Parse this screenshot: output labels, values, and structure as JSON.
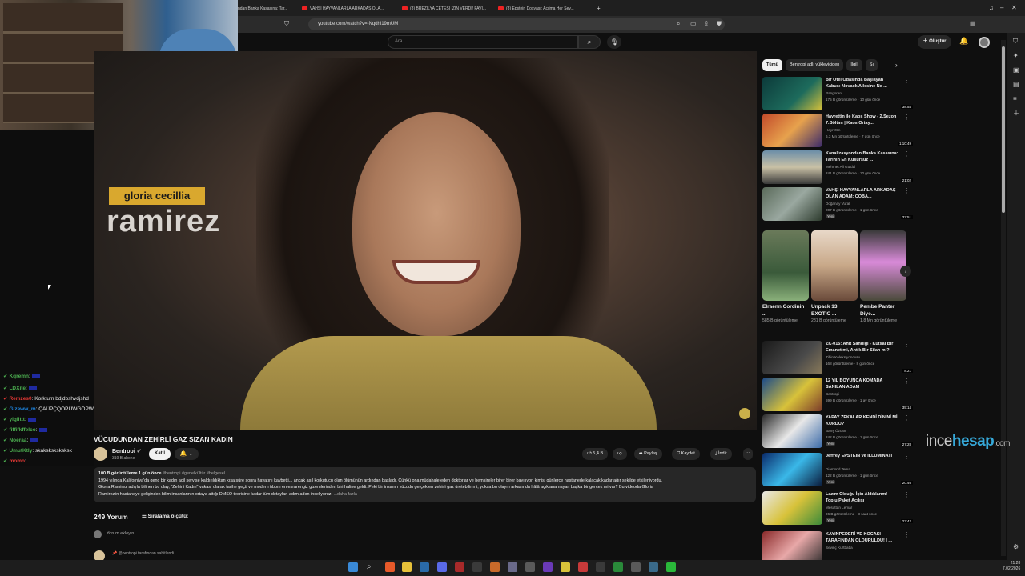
{
  "browser": {
    "tabs": [
      {
        "label": "ndan Banka Kasasına: Tar..."
      },
      {
        "label": "VAHŞİ HAYVANLARLA ARKADAŞ OLA..."
      },
      {
        "label": "(8) BREZİLYA ÇETESİ İZİN VERDİ! FAVI..."
      },
      {
        "label": "(8) Epstein Dosyası: Açılma Her Şey..."
      }
    ],
    "new_tab": "+",
    "url": "youtube.com/watch?v=-Nqdhi19mUM"
  },
  "header": {
    "search_placeholder": "Ara",
    "create_label": "Oluştur"
  },
  "chat": [
    {
      "user": "Kqremn",
      "msg": ":",
      "color": "#4caf50"
    },
    {
      "user": "LDXite",
      "msg": ":",
      "color": "#4caf50"
    },
    {
      "user": "Remzes0",
      "msg": ": Korktum bdjdbshvdjshd",
      "color": "#e53935"
    },
    {
      "user": "Gizeww_m",
      "msg": ": ÇAÜPÇQÖPÜWĞÖPWĞŞÖĞPÖWWWPĞÇWŞ",
      "color": "#1e88e5"
    },
    {
      "user": "yiglittt",
      "msg": ":",
      "color": "#4caf50"
    },
    {
      "user": "fiffifkffelco",
      "msg": ":",
      "color": "#4caf50"
    },
    {
      "user": "Noeraa",
      "msg": ":",
      "color": "#4caf50"
    },
    {
      "user": "UmutKtly",
      "msg": ": skaksksksksksk",
      "color": "#4caf50"
    },
    {
      "user": "momo",
      "msg": ":",
      "color": "#e53935"
    }
  ],
  "video": {
    "overlay_first": "gloria cecillia",
    "overlay_last": "ramirez",
    "title": "VÜCUDUNDAN ZEHİRLİ GAZ SIZAN KADIN"
  },
  "channel": {
    "name": "Bentropi",
    "subscribers": "319 B abone",
    "join_label": "Katıl",
    "bell_label": "🔔 ⌄"
  },
  "actions": {
    "likes": "5,4 B",
    "share": "Paylaş",
    "save": "Kaydet",
    "download": "İndir",
    "more": "⋯"
  },
  "description": {
    "meta": "100 B görüntüleme  1 gün önce",
    "tags": "#bentropi #genelkültür #belgesel",
    "line1": "1994 yılında Kaliforniya'da genç bir kadın acil servise kaldırıldıktan kısa süre sonra hayatını kaybetti... ancak asıl korkutucu olan ölümünün ardından başladı. Çünkü ona müdahale eden doktorlar ve hemşireler birer birer bayılıyor, kimisi günlerce hastanede kalacak kadar ağır şekilde etkileniyordu.",
    "line2": "Gloria Ramirez adıyla bilinen bu olay, \"Zehirli Kadın\" vakası olarak tarihe geçti ve modern tıbbın en esrarengiz gizemlerinden biri haline geldi. Peki bir insanın vücudu gerçekten zehirli gaz üretebilir mi, yoksa bu olayın arkasında hâlâ açıklanamayan başka bir gerçek mi var? Bu videoda Gloria",
    "line3": "Ramirez'in hastaneye gelişinden bilim insanlarının ortaya attığı DMSO teorisine kadar tüm detayları adım adım inceliyoruz.",
    "more": "...daha fazla"
  },
  "comments": {
    "count": "249 Yorum",
    "sort": "Sıralama ölçütü:",
    "add_placeholder": "Yorum ekleyin...",
    "first_note": "📌 @bentropi tarafından sabitlendi"
  },
  "chips": [
    "Tümü",
    "Bentropi adlı yükleyiciden",
    "İlgili",
    "Sı"
  ],
  "recommendations": [
    {
      "title": "Bir Otel Odasında Başlayan Kabus: Novack Ailesine Ne ...",
      "channel": "Pangoran",
      "meta": "175 B görüntüleme · 10 gün önce",
      "duration": "38:54",
      "badge": "",
      "thumb": "linear-gradient(135deg,#0c3a3a,#1d6b5c 60%,#d8c23a)"
    },
    {
      "title": "Hayrettin ile Kaos Show - 2.Sezon 7.Bölüm | Kaos Ortay...",
      "channel": "Hayrettin",
      "meta": "6,3 Mn görüntüleme · 7 gün önce",
      "duration": "1:10:49",
      "badge": "",
      "thumb": "linear-gradient(135deg,#c24a2a,#e7a24d 50%,#3a2a6a)"
    },
    {
      "title": "Kanalizasyondan Banka Kasasına: Tarihin En Kusursuz ...",
      "channel": "Mehmet Ali Güldal",
      "meta": "241 B görüntüleme · 10 gün önce",
      "duration": "21:02",
      "badge": "",
      "thumb": "linear-gradient(180deg,#6b8ea8,#c9c1a6 50%,#3a3a3a)"
    },
    {
      "title": "VAHŞİ HAYVANLARLA ARKADAŞ OLAN ADAM: ÇOBA...",
      "channel": "Doğanay Vural",
      "meta": "207 B görüntüleme · 1 gün önce",
      "duration": "32:51",
      "badge": "Yeni",
      "thumb": "linear-gradient(135deg,#5a6a5a,#9aa8a0 50%,#2c3a2c)"
    },
    {
      "title": "ZK-015: Ahit Sandığı - Kutsal Bir Emanet mi, Antik Bir Silah mı?",
      "channel": "Zihin Koleksiyoncusu",
      "meta": "168 görüntüleme · 8 gün önce",
      "duration": "8:21",
      "badge": "",
      "thumb": "linear-gradient(135deg,#1a1a1a,#4a4a4a 60%,#8a7a5a)"
    },
    {
      "title": "12 YIL BOYUNCA KOMADA SANILAN ADAM",
      "channel": "Bentropi",
      "meta": "599 B görüntüleme · 1 ay önce",
      "duration": "35:14",
      "badge": "",
      "thumb": "linear-gradient(135deg,#1a4a8a,#d8c23a 55%,#7a3a2a)"
    },
    {
      "title": "YAPAY ZEKALAR KENDİ DİNİNİ Mİ KURDU?",
      "channel": "Barış Özcan",
      "meta": "242 B görüntüleme · 1 gün önce",
      "duration": "27:28",
      "badge": "Yeni",
      "thumb": "linear-gradient(135deg,#2a2a2a,#e8e8e8 50%,#3a6aa8)"
    },
    {
      "title": "Jeffrey EPSTEIN ve ILLUMINATI !",
      "channel": "Diamond Tema",
      "meta": "122 B görüntüleme · 1 gün önce",
      "duration": "20:46",
      "badge": "Yeni",
      "thumb": "linear-gradient(135deg,#0a2a6a,#3ab8e8 50%,#0a1a3a)"
    },
    {
      "title": "Lazım Olduğu İçin Aldıklarım! Toplu Paket Açılışı",
      "channel": "Mesuttan Lemar",
      "meta": "96 B görüntüleme · 3 saat önce",
      "duration": "23:42",
      "badge": "Yeni",
      "thumb": "linear-gradient(135deg,#e8e8e8,#d8c23a 50%,#3a8a3a)"
    },
    {
      "title": "KAYINPEDERİ VE KOCASI TARAFINDAN ÖLDÜRÜLDÜ! | ...",
      "channel": "Sevinç Kurtbaba",
      "meta": "",
      "duration": "",
      "badge": "",
      "thumb": "linear-gradient(135deg,#8a2a2a,#e8a8a8 50%,#2a2a2a)"
    }
  ],
  "shorts": [
    {
      "title": "Elraenn Cordinin ...",
      "views": "585 B görüntüleme",
      "thumb": "linear-gradient(180deg,#6a7a5a,#3a5a3a 60%,#8ab07a)"
    },
    {
      "title": "Unpack 13 EXOTIC ...",
      "views": "281 B görüntüleme",
      "thumb": "linear-gradient(180deg,#e8d8c8,#c8a888 50%,#6a4a3a)"
    },
    {
      "title": "Pembe Panter Diye...",
      "views": "1,8 Mn görüntüleme",
      "thumb": "linear-gradient(180deg,#3a3a3a,#d88ad8 45%,#4a4a3a)"
    }
  ],
  "watermark": {
    "a": "ince",
    "b": "hesap",
    "c": ".com"
  },
  "taskbar": {
    "time": "21:28",
    "date": "7.02.2026"
  }
}
